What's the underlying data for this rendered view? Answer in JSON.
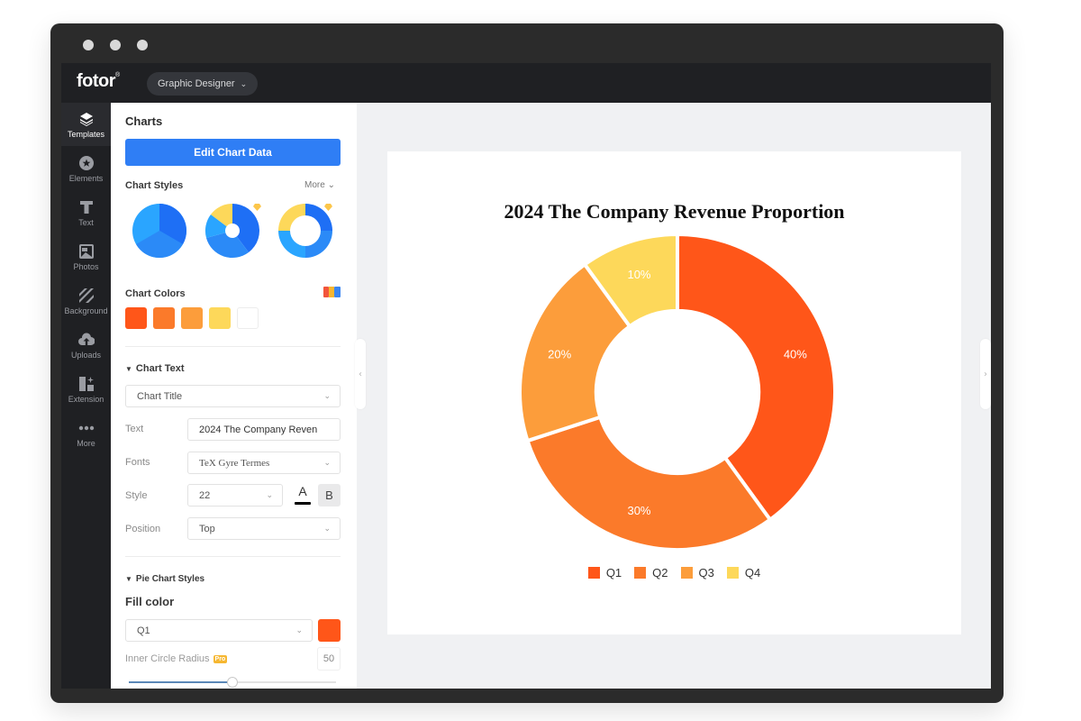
{
  "window": {
    "dots": 3
  },
  "topbar": {
    "logo": "fotor",
    "logo_mark": "®",
    "mode": "Graphic Designer"
  },
  "rail": [
    {
      "label": "Templates",
      "icon": "layers-icon",
      "active": true
    },
    {
      "label": "Elements",
      "icon": "star-circle-icon"
    },
    {
      "label": "Text",
      "icon": "text-icon"
    },
    {
      "label": "Photos",
      "icon": "photo-icon"
    },
    {
      "label": "Background",
      "icon": "stripes-icon"
    },
    {
      "label": "Uploads",
      "icon": "cloud-upload-icon"
    },
    {
      "label": "Extension",
      "icon": "extension-icon"
    },
    {
      "label": "More",
      "icon": "more-dots-icon"
    }
  ],
  "panel": {
    "title": "Charts",
    "edit_button": "Edit Chart Data",
    "chart_styles_label": "Chart Styles",
    "more_label": "More",
    "chart_colors_label": "Chart Colors",
    "colors": [
      "#ff5619",
      "#fb7a2a",
      "#fc9d3b",
      "#fdd85a",
      "#ffffff"
    ],
    "chart_text_label": "Chart Text",
    "chart_text_target": "Chart Title",
    "text_label": "Text",
    "text_value": "2024 The Company Reven",
    "fonts_label": "Fonts",
    "font_value": "TeX Gyre Termes",
    "style_label": "Style",
    "size_value": "22",
    "color_button": "A",
    "bold_button": "B",
    "position_label": "Position",
    "position_value": "Top",
    "pie_styles_label": "Pie Chart Styles",
    "fill_color_label": "Fill color",
    "fill_series": "Q1",
    "fill_color": "#ff5619",
    "inner_radius_label": "Inner Circle Radius",
    "pro_badge": "Pro",
    "inner_radius_value": "50",
    "inner_radius_fraction": 0.5
  },
  "chart_data": {
    "type": "pie",
    "variant": "donut",
    "title": "2024 The Company Revenue Proportion",
    "categories": [
      "Q1",
      "Q2",
      "Q3",
      "Q4"
    ],
    "values": [
      40,
      30,
      20,
      10
    ],
    "labels": [
      "40%",
      "30%",
      "20%",
      "10%"
    ],
    "colors": [
      "#ff5619",
      "#fb7a2a",
      "#fc9d3b",
      "#fdd85a"
    ],
    "inner_radius_percent": 50,
    "legend": "bottom"
  }
}
